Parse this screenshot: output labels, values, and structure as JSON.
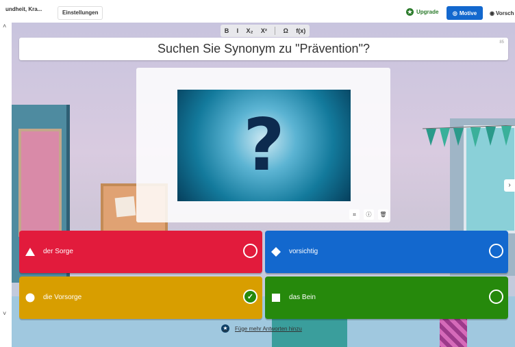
{
  "header": {
    "quiz_title": "undheit, Kra...",
    "settings_label": "Einstellungen",
    "upgrade_label": "Upgrade",
    "motive_label": "Motive",
    "preview_label": "Vorsch"
  },
  "toolbar": {
    "bold": "B",
    "italic": "I",
    "subscript": "X₂",
    "superscript": "X²",
    "omega": "Ω",
    "function": "f(x)"
  },
  "question": {
    "text": "Suchen Sie Synonym zu \"Prävention\"?",
    "char_count": "85"
  },
  "media": {
    "image_glyph": "?"
  },
  "answers": [
    {
      "text": "der Sorge",
      "shape": "triangle",
      "color": "#e21b3c",
      "correct": false
    },
    {
      "text": "vorsichtig",
      "shape": "diamond",
      "color": "#1368ce",
      "correct": false
    },
    {
      "text": "die Vorsorge",
      "shape": "circle",
      "color": "#d89e00",
      "correct": true
    },
    {
      "text": "das Bein",
      "shape": "square",
      "color": "#26890c",
      "correct": false
    }
  ],
  "add_more_label": "Füge mehr Antworten hinzu",
  "icons": {
    "upgrade": "star-icon",
    "motive": "palette-icon",
    "preview": "eye-icon",
    "crop": "crop-icon",
    "info": "info-icon",
    "delete": "trash-icon",
    "next": "chevron-right-icon"
  }
}
